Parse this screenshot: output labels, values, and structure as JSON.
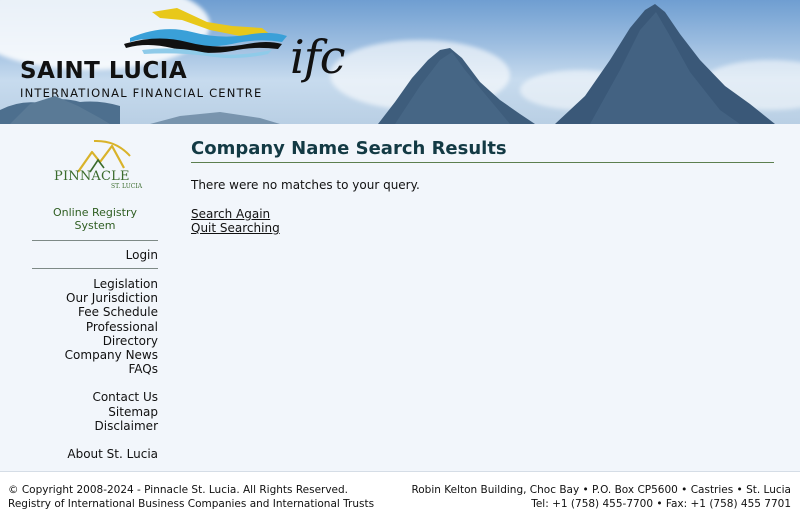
{
  "header": {
    "logo_main": "SAINT LUCIA",
    "logo_sub": "INTERNATIONAL FINANCIAL CENTRE",
    "logo_ifc": "ifc"
  },
  "sidebar": {
    "brand_word": "PINNACLE",
    "brand_sub": "ST. LUCIA",
    "registry_title": "Online Registry System",
    "login_label": "Login",
    "nav_primary": [
      "Legislation",
      "Our Jurisdiction",
      "Fee Schedule",
      "Professional Directory",
      "Company News",
      "FAQs"
    ],
    "nav_secondary": [
      "Contact Us",
      "Sitemap",
      "Disclaimer"
    ],
    "nav_tertiary": [
      "About St. Lucia"
    ]
  },
  "main": {
    "title": "Company Name Search Results",
    "message": "There were no matches to your query.",
    "search_again": "Search Again",
    "quit_searching": "Quit Searching"
  },
  "footer": {
    "copyright": "© Copyright 2008-2024 - Pinnacle St. Lucia. All Rights Reserved.",
    "registry_line": "Registry of International Business Companies and International Trusts",
    "address": "Robin Kelton Building, Choc Bay • P.O. Box CP5600 • Castries • St. Lucia",
    "contact": "Tel: +1 (758) 455-7700 • Fax: +1 (758) 455 7701"
  },
  "colors": {
    "title": "#133a44",
    "registry_green": "#2f5e22",
    "content_bg": "#f2f6fb"
  }
}
